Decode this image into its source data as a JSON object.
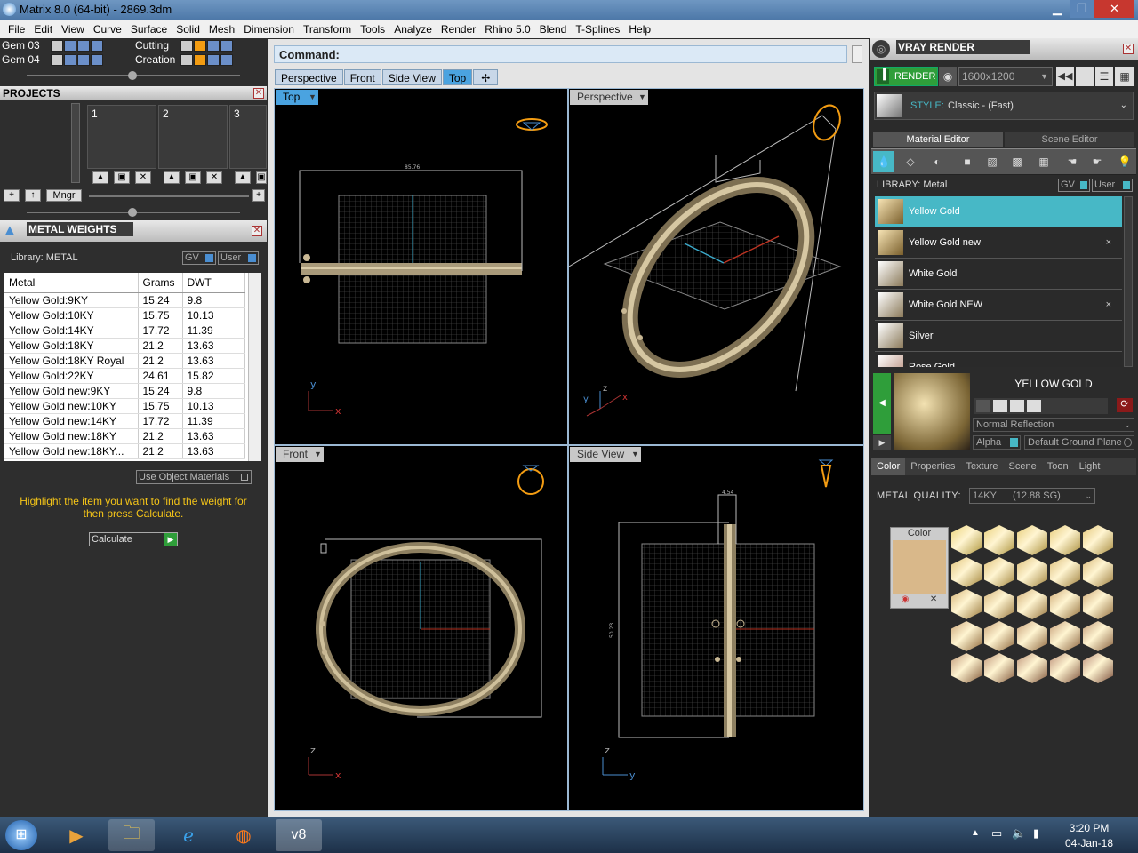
{
  "window": {
    "title": "Matrix 8.0 (64-bit) - 2869.3dm",
    "min": "▁",
    "max": "❐",
    "close": "✕"
  },
  "menu": [
    "File",
    "Edit",
    "View",
    "Curve",
    "Surface",
    "Solid",
    "Mesh",
    "Dimension",
    "Transform",
    "Tools",
    "Analyze",
    "Render",
    "Rhino 5.0",
    "Blend",
    "T-Splines",
    "Help"
  ],
  "gems": [
    {
      "label": "Gem 03"
    },
    {
      "label": "Gem 04"
    }
  ],
  "gemtools": [
    {
      "label": "Cutting"
    },
    {
      "label": "Creation"
    }
  ],
  "projects": {
    "title": "PROJECTS",
    "slots": [
      "1",
      "2",
      "3"
    ],
    "mngr": "Mngr"
  },
  "metal_weights": {
    "title": "METAL WEIGHTS",
    "library": "Library: METAL",
    "gv": "GV",
    "user": "User",
    "columns": [
      "Metal",
      "Grams",
      "DWT"
    ],
    "rows": [
      [
        "Yellow Gold:9KY",
        "15.24",
        "9.8"
      ],
      [
        "Yellow Gold:10KY",
        "15.75",
        "10.13"
      ],
      [
        "Yellow Gold:14KY",
        "17.72",
        "11.39"
      ],
      [
        "Yellow Gold:18KY",
        "21.2",
        "13.63"
      ],
      [
        "Yellow Gold:18KY Royal",
        "21.2",
        "13.63"
      ],
      [
        "Yellow Gold:22KY",
        "24.61",
        "15.82"
      ],
      [
        "Yellow Gold new:9KY",
        "15.24",
        "9.8"
      ],
      [
        "Yellow Gold new:10KY",
        "15.75",
        "10.13"
      ],
      [
        "Yellow Gold new:14KY",
        "17.72",
        "11.39"
      ],
      [
        "Yellow Gold new:18KY",
        "21.2",
        "13.63"
      ],
      [
        "Yellow Gold new:18KY...",
        "21.2",
        "13.63"
      ]
    ],
    "use_object_materials": "Use Object Materials",
    "hint": "Highlight the item you want to find the weight for then press Calculate.",
    "calculate": "Calculate"
  },
  "command": {
    "label": "Command:"
  },
  "viewtabs": [
    {
      "label": "Perspective"
    },
    {
      "label": "Front"
    },
    {
      "label": "Side View"
    },
    {
      "label": "Top"
    }
  ],
  "viewports": {
    "top": "Top",
    "perspective": "Perspective",
    "front": "Front",
    "side": "Side View",
    "dim_top": "85.76",
    "dim_side_h": "4.54",
    "dim_side_v": "50.23"
  },
  "axes": {
    "x": "x",
    "y": "y",
    "z": "z"
  },
  "vray": {
    "title": "VRAY RENDER",
    "render": "RENDER",
    "resolution": "1600x1200",
    "style_label": "STYLE:",
    "style_value": "Classic - (Fast)"
  },
  "editor_tabs": [
    "Material Editor",
    "Scene Editor"
  ],
  "library": {
    "label": "LIBRARY: Metal",
    "gv": "GV",
    "user": "User",
    "items": [
      {
        "name": "Yellow Gold",
        "x": ""
      },
      {
        "name": "Yellow Gold new",
        "x": "×"
      },
      {
        "name": "White Gold",
        "x": ""
      },
      {
        "name": "White Gold NEW",
        "x": "×"
      },
      {
        "name": "Silver",
        "x": ""
      },
      {
        "name": "Rose Gold",
        "x": ""
      }
    ]
  },
  "preview": {
    "name": "YELLOW GOLD",
    "reflection": "Normal Reflection",
    "alpha": "Alpha",
    "ground": "Default Ground Plane"
  },
  "subtabs": [
    "Color",
    "Properties",
    "Texture",
    "Scene",
    "Toon",
    "Light"
  ],
  "metal_quality": {
    "label": "METAL QUALITY:",
    "value": "14KY      (12.88 SG)"
  },
  "color_box": {
    "label": "Color",
    "swatch": "#d9b88a"
  },
  "clock": {
    "time": "3:20 PM",
    "date": "04-Jan-18"
  }
}
